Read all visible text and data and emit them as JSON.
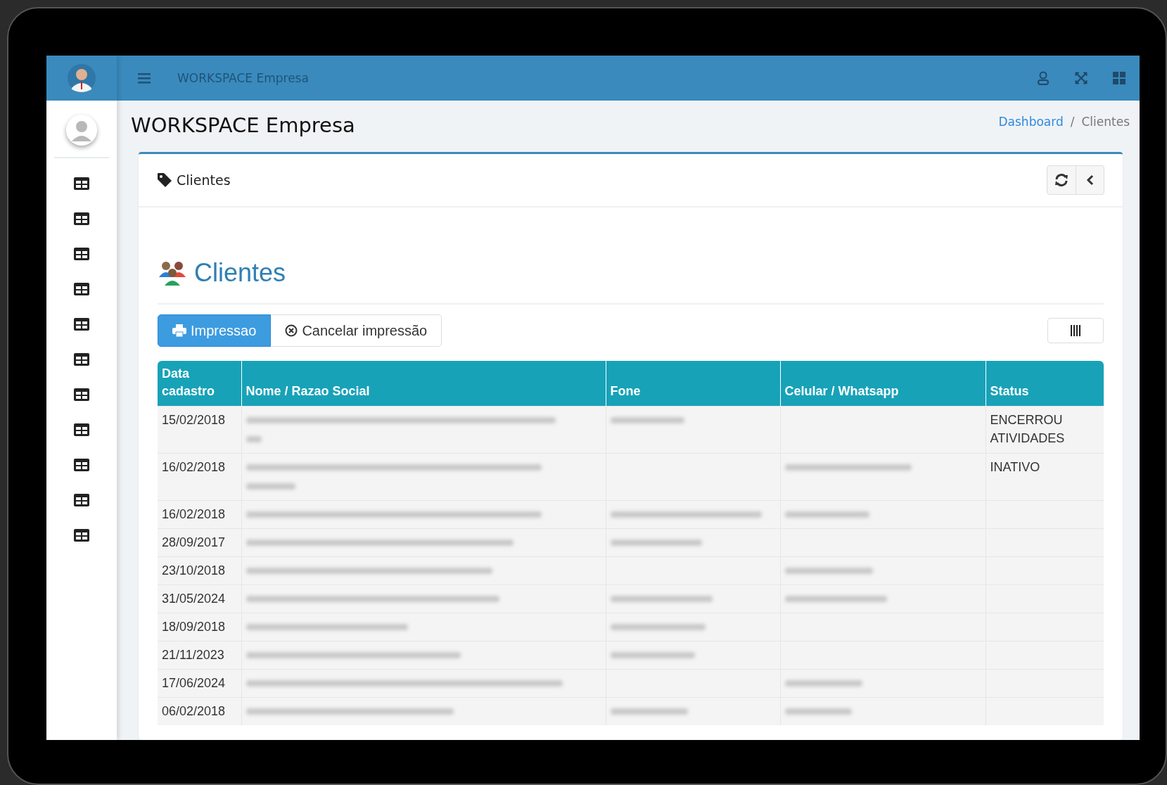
{
  "topbar": {
    "title": "WORKSPACE Empresa"
  },
  "page": {
    "title": "WORKSPACE Empresa",
    "breadcrumb_separator": "/",
    "breadcrumb": [
      {
        "label": "Dashboard",
        "link": true
      },
      {
        "label": "Clientes",
        "link": false
      }
    ]
  },
  "card": {
    "header": "Clientes",
    "heading": "Clientes",
    "buttons": [
      {
        "label": "Impressao",
        "kind": "print",
        "selected": true
      },
      {
        "label": "Cancelar impressão",
        "kind": "cancel",
        "selected": false
      }
    ]
  },
  "table": {
    "columns": [
      "Data cadastro",
      "Nome / Razao Social",
      "Fone",
      "Celular / Whatsapp",
      "Status"
    ],
    "rows": [
      {
        "date": "15/02/2018",
        "name_blurred": true,
        "name_wraps": true,
        "fone_blurred": true,
        "celular_blurred": false,
        "status": "ENCERROU ATIVIDADES"
      },
      {
        "date": "16/02/2018",
        "name_blurred": true,
        "name_wraps": true,
        "fone_blurred": false,
        "celular_blurred": true,
        "status": "INATIVO"
      },
      {
        "date": "16/02/2018",
        "name_blurred": true,
        "name_wraps": false,
        "fone_blurred": true,
        "celular_blurred": true
      },
      {
        "date": "28/09/2017",
        "name_blurred": true,
        "name_wraps": false,
        "fone_blurred": true,
        "celular_blurred": false
      },
      {
        "date": "23/10/2018",
        "name_blurred": true,
        "name_wraps": false,
        "fone_blurred": false,
        "celular_blurred": true
      },
      {
        "date": "31/05/2024",
        "name_blurred": true,
        "name_wraps": false,
        "fone_blurred": true,
        "celular_blurred": true
      },
      {
        "date": "18/09/2018",
        "name_blurred": true,
        "name_wraps": false,
        "fone_blurred": true,
        "celular_blurred": false
      },
      {
        "date": "21/11/2023",
        "name_blurred": true,
        "name_wraps": false,
        "fone_blurred": true,
        "celular_blurred": false
      },
      {
        "date": "17/06/2024",
        "name_blurred": true,
        "name_wraps": false,
        "fone_blurred": false,
        "celular_blurred": true
      },
      {
        "date": "06/02/2018",
        "name_blurred": true,
        "name_wraps": false,
        "fone_blurred": true,
        "celular_blurred": true
      }
    ]
  }
}
